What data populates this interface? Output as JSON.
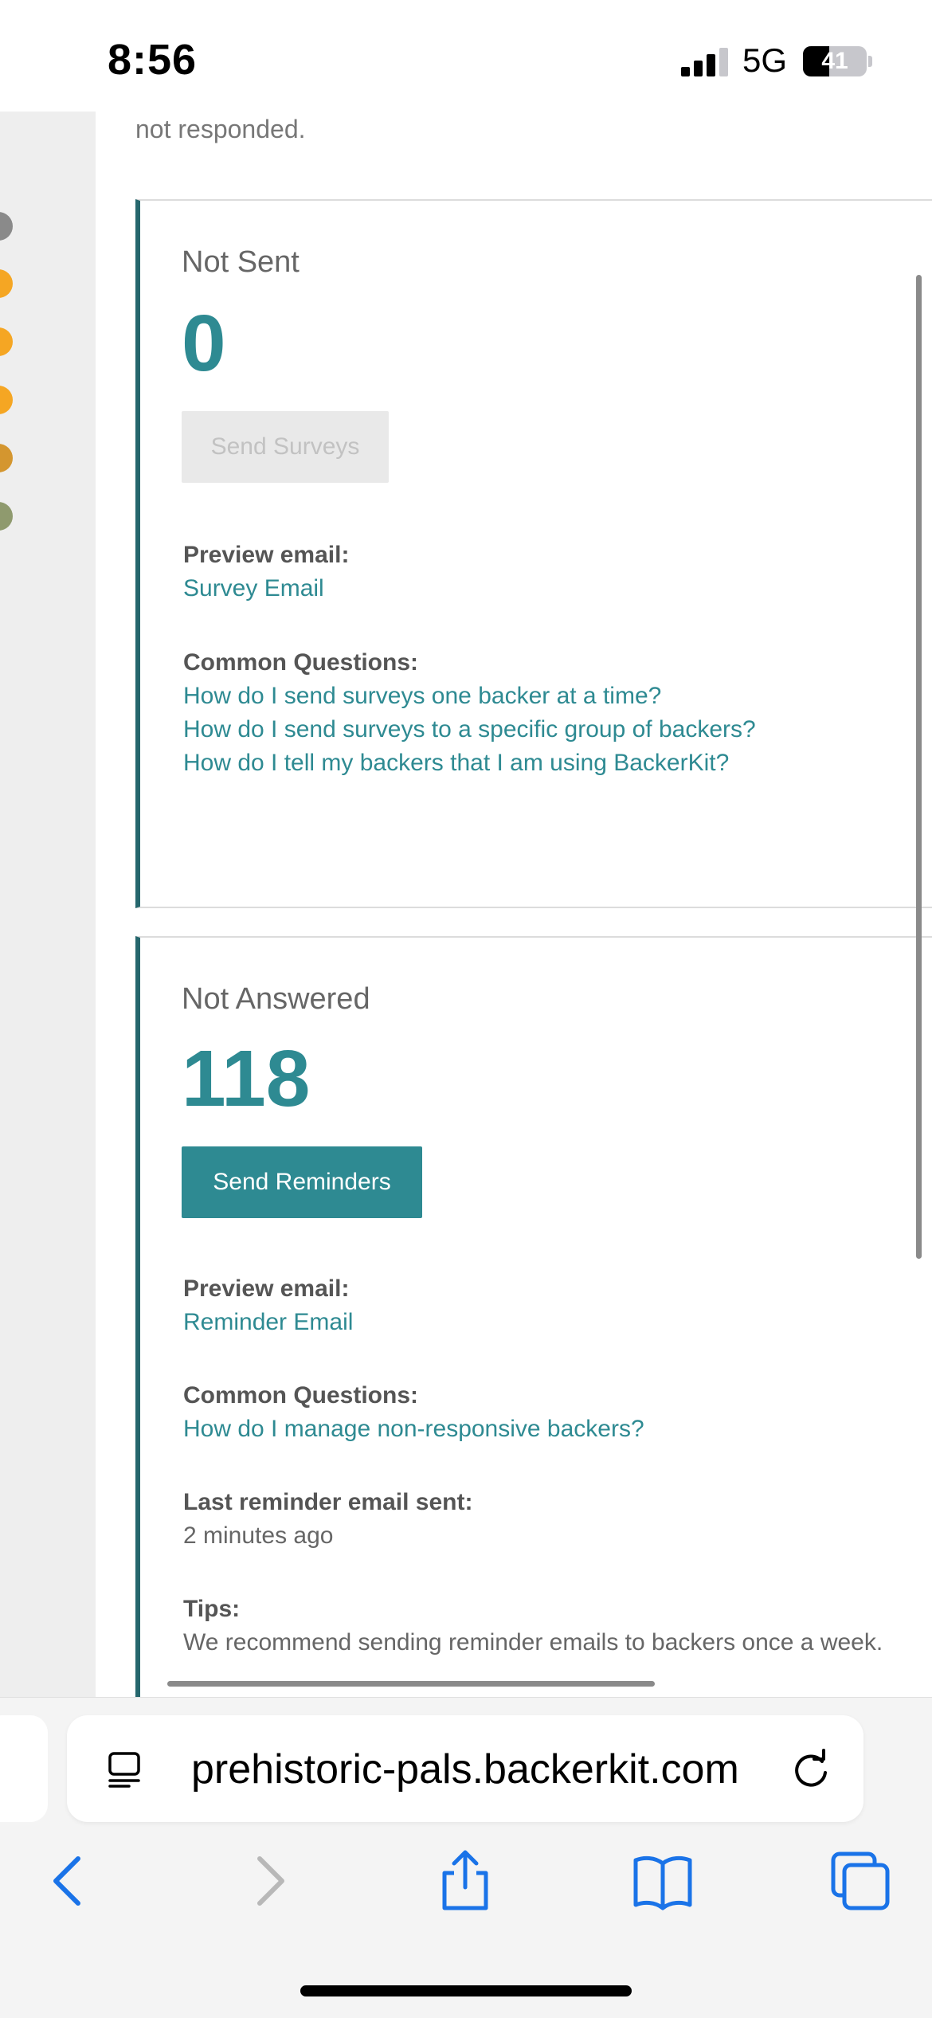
{
  "status_bar": {
    "time": "8:56",
    "network": "5G",
    "battery_level": "41"
  },
  "page": {
    "intro_text": "not responded.",
    "cards": [
      {
        "title": "Not Sent",
        "count": "0",
        "button_label": "Send Surveys",
        "button_enabled": false,
        "preview_label": "Preview email:",
        "preview_link": "Survey Email",
        "questions_label": "Common Questions:",
        "questions": [
          "How do I send surveys one backer at a time?",
          "How do I send surveys to a specific group of backers?",
          "How do I tell my backers that I am using BackerKit?"
        ]
      },
      {
        "title": "Not Answered",
        "count": "118",
        "button_label": "Send Reminders",
        "button_enabled": true,
        "preview_label": "Preview email:",
        "preview_link": "Reminder Email",
        "questions_label": "Common Questions:",
        "questions": [
          "How do I manage non-responsive backers?"
        ],
        "last_reminder_label": "Last reminder email sent:",
        "last_reminder_value": "2 minutes ago",
        "tips_label": "Tips:",
        "tips_value": "We recommend sending reminder emails to backers once a week."
      }
    ]
  },
  "browser": {
    "url": "prehistoric-pals.backerkit.com",
    "toolbar_icons": [
      "back-icon",
      "forward-icon",
      "share-icon",
      "bookmarks-icon",
      "tabs-icon"
    ]
  },
  "colors": {
    "accent": "#2e8a92",
    "card_border": "#26676d",
    "sidebar_dots": [
      "#8a8a8a",
      "#f5a623",
      "#f5a623",
      "#f5a623",
      "#d4962f",
      "#8f9a6e"
    ]
  }
}
